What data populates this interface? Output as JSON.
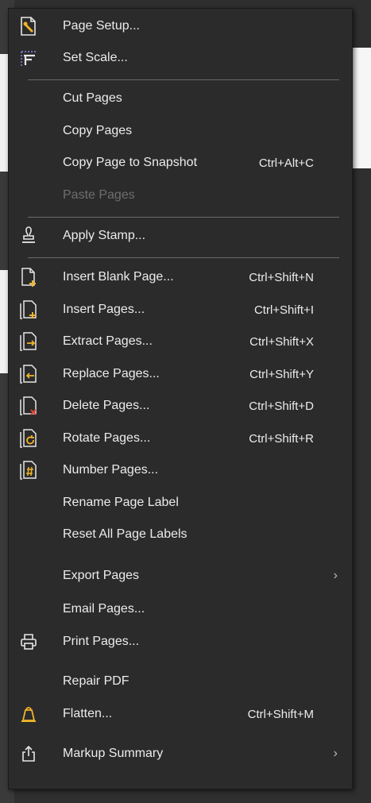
{
  "menu": {
    "items": [
      {
        "id": "page-setup",
        "label": "Page Setup...",
        "shortcut": "",
        "icon": "page-setup-icon"
      },
      {
        "id": "set-scale",
        "label": "Set Scale...",
        "shortcut": "",
        "icon": "set-scale-icon"
      },
      {
        "id": "cut-pages",
        "label": "Cut Pages",
        "shortcut": ""
      },
      {
        "id": "copy-pages",
        "label": "Copy Pages",
        "shortcut": ""
      },
      {
        "id": "copy-page-snapshot",
        "label": "Copy Page to Snapshot",
        "shortcut": "Ctrl+Alt+C"
      },
      {
        "id": "paste-pages",
        "label": "Paste Pages",
        "shortcut": "",
        "disabled": true
      },
      {
        "id": "apply-stamp",
        "label": "Apply Stamp...",
        "shortcut": "",
        "icon": "stamp-icon"
      },
      {
        "id": "insert-blank-page",
        "label": "Insert Blank Page...",
        "shortcut": "Ctrl+Shift+N",
        "icon": "insert-blank-page-icon"
      },
      {
        "id": "insert-pages",
        "label": "Insert Pages...",
        "shortcut": "Ctrl+Shift+I",
        "icon": "insert-pages-icon"
      },
      {
        "id": "extract-pages",
        "label": "Extract Pages...",
        "shortcut": "Ctrl+Shift+X",
        "icon": "extract-pages-icon"
      },
      {
        "id": "replace-pages",
        "label": "Replace Pages...",
        "shortcut": "Ctrl+Shift+Y",
        "icon": "replace-pages-icon"
      },
      {
        "id": "delete-pages",
        "label": "Delete Pages...",
        "shortcut": "Ctrl+Shift+D",
        "icon": "delete-pages-icon"
      },
      {
        "id": "rotate-pages",
        "label": "Rotate Pages...",
        "shortcut": "Ctrl+Shift+R",
        "icon": "rotate-pages-icon"
      },
      {
        "id": "number-pages",
        "label": "Number Pages...",
        "shortcut": "",
        "icon": "number-pages-icon"
      },
      {
        "id": "rename-page-label",
        "label": "Rename Page Label",
        "shortcut": ""
      },
      {
        "id": "reset-page-labels",
        "label": "Reset All Page Labels",
        "shortcut": ""
      },
      {
        "id": "export-pages",
        "label": "Export Pages",
        "shortcut": "",
        "submenu": true
      },
      {
        "id": "email-pages",
        "label": "Email Pages...",
        "shortcut": ""
      },
      {
        "id": "print-pages",
        "label": "Print Pages...",
        "shortcut": "",
        "icon": "printer-icon"
      },
      {
        "id": "repair-pdf",
        "label": "Repair PDF",
        "shortcut": ""
      },
      {
        "id": "flatten",
        "label": "Flatten...",
        "shortcut": "Ctrl+Shift+M",
        "icon": "flatten-icon"
      },
      {
        "id": "markup-summary",
        "label": "Markup Summary",
        "shortcut": "",
        "icon": "share-export-icon",
        "submenu": true
      }
    ]
  },
  "submenu_arrow": "›",
  "colors": {
    "menu_bg": "#2b2b2b",
    "text": "#ececec",
    "disabled": "#6e6e6e",
    "accent": "#f0b429"
  }
}
